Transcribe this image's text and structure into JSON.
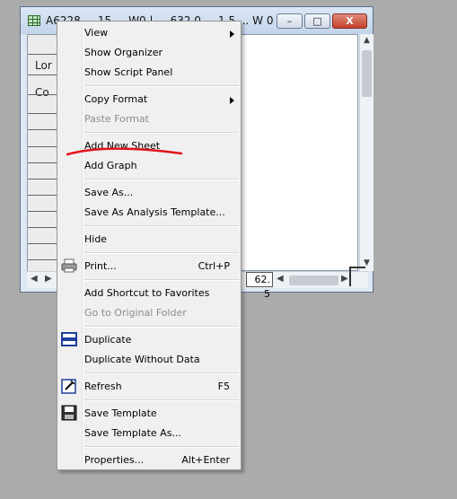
{
  "window": {
    "title": "A6228 ... 15 ... W0 | ... 632.0 ... 1.5 ... W 0 de...",
    "min_label": "–",
    "max_label": "□",
    "close_label": "X",
    "row_labels": [
      "Lor",
      "Co"
    ],
    "sheet_tab": "62. 5"
  },
  "menu": {
    "items": [
      {
        "label": "View",
        "submenu": true
      },
      {
        "label": "Show Organizer"
      },
      {
        "label": "Show Script Panel"
      },
      {
        "label": "Copy Format",
        "submenu": true
      },
      {
        "label": "Paste Format",
        "disabled": true
      },
      {
        "label": "Add New Sheet"
      },
      {
        "label": "Add Graph"
      },
      {
        "label": "Save As..."
      },
      {
        "label": "Save As Analysis Template..."
      },
      {
        "label": "Hide"
      },
      {
        "label": "Print...",
        "shortcut": "Ctrl+P",
        "icon": "printer-icon"
      },
      {
        "label": "Add Shortcut to Favorites"
      },
      {
        "label": "Go to Original Folder",
        "disabled": true
      },
      {
        "label": "Duplicate",
        "icon": "duplicate-icon"
      },
      {
        "label": "Duplicate Without Data"
      },
      {
        "label": "Refresh",
        "shortcut": "F5",
        "icon": "refresh-icon"
      },
      {
        "label": "Save Template",
        "icon": "save-template-icon"
      },
      {
        "label": "Save Template As..."
      },
      {
        "label": "Properties...",
        "shortcut": "Alt+Enter"
      }
    ]
  },
  "annotation": {
    "color": "#e0141b"
  }
}
